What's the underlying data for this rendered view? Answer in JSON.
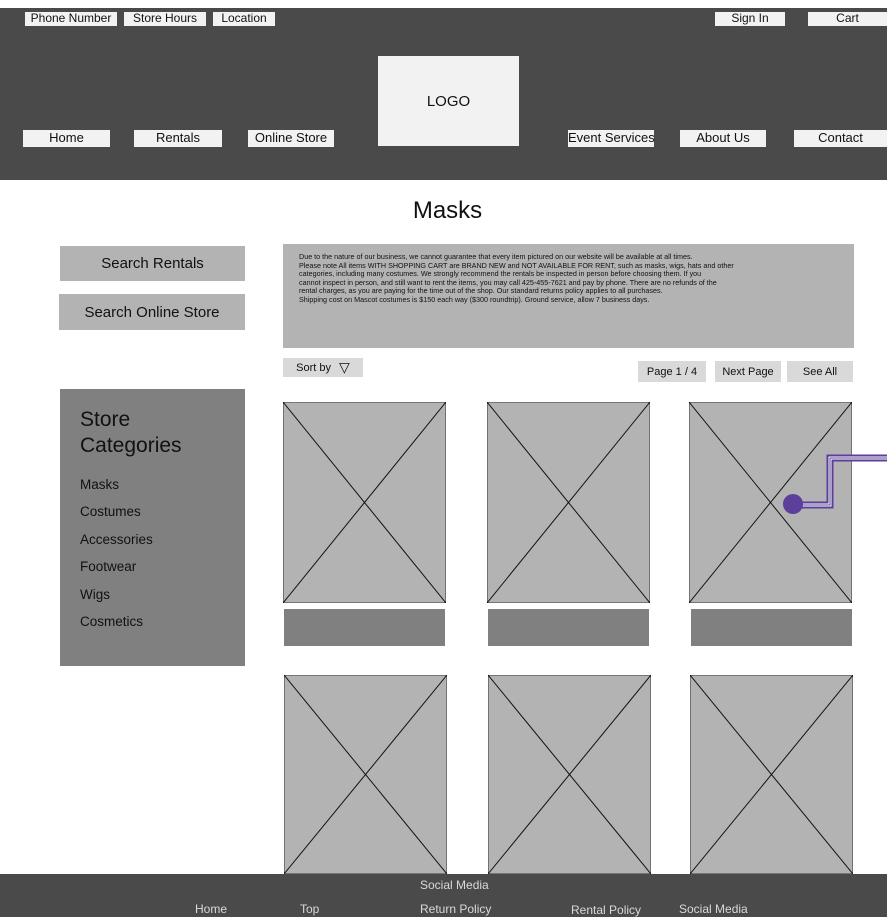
{
  "utility_bar": {
    "phone_label": "Phone Number",
    "hours_label": "Store Hours",
    "location_label": "Location",
    "signin_label": "Sign In",
    "cart_label": "Cart"
  },
  "logo": {
    "text": "LOGO"
  },
  "nav": {
    "home": "Home",
    "rentals": "Rentals",
    "online_store": "Online Store",
    "event_services": "Event Services",
    "about_us": "About Us",
    "contact": "Contact"
  },
  "page": {
    "title": "Masks"
  },
  "sidebar": {
    "search_rentals": "Search Rentals",
    "search_online_store": "Search Online Store",
    "categories_title": "Store Categories",
    "categories": [
      "Masks",
      "Costumes",
      "Accessories",
      "Footwear",
      "Wigs",
      "Cosmetics"
    ]
  },
  "notice": {
    "lines": [
      "Due to the nature of our business, we cannot guarantee that every item pictured on our website will be available at all times.",
      "Please note All items WITH SHOPPING CART are BRAND NEW and NOT AVAILABLE FOR RENT, such as masks, wigs, hats and other",
      "categories, including many costumes. We strongly recommend the rentals be inspected in person before choosing them. If you",
      "cannot inspect in person, and still want to rent the items, you may call 425-455-7621 and pay by phone. There are no refunds of the",
      "rental charges, as you are paying for the time out of the shop. Our standard returns policy applies to all purchases.",
      "Shipping cost on Mascot costumes is $150 each way ($300 roundtrip). Ground service, allow 7 business days."
    ]
  },
  "toolbar": {
    "sort_label": "Sort by",
    "sort_icon": "▽",
    "page_indicator": "Page 1 / 4",
    "next_page": "Next Page",
    "see_all": "See All"
  },
  "footer": {
    "social_heading": "Social Media",
    "home": "Home",
    "top": "Top",
    "return_policy": "Return Policy",
    "rental_policy": "Rental Policy",
    "social_media": "Social Media"
  },
  "colors": {
    "header_bg": "#4a4a4a",
    "placeholder": "#b3b3b3",
    "panel": "#808080",
    "annotation": "#5b3f9a"
  }
}
